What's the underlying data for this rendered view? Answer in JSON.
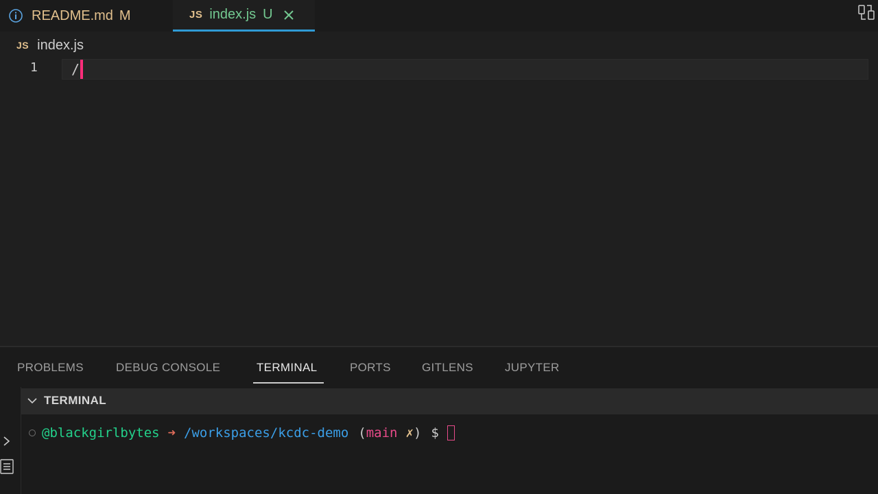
{
  "tabs": [
    {
      "title": "README.md",
      "status": "M"
    },
    {
      "title": "index.js",
      "status": "U"
    }
  ],
  "js_icon_label": "JS",
  "breadcrumb": {
    "file": "index.js"
  },
  "editor": {
    "line_number": "1",
    "code": "/"
  },
  "panel": {
    "tabs": [
      "PROBLEMS",
      "DEBUG CONSOLE",
      "TERMINAL",
      "PORTS",
      "GITLENS",
      "JUPYTER"
    ],
    "active_tab": "TERMINAL",
    "section_title": "TERMINAL"
  },
  "terminal": {
    "user": "@blackgirlbytes",
    "arrow": "➜",
    "path": "/workspaces/kcdc-demo",
    "paren_open": "(",
    "branch": "main",
    "dirty": "✗",
    "paren_close": ")",
    "prompt": "$"
  },
  "colors": {
    "accent": "#2f9bd6",
    "modified": "#e2c08d",
    "untracked": "#73c991",
    "cursor": "#ff2d7a"
  },
  "icons": [
    "info-icon",
    "js-icon",
    "close-icon",
    "compare-changes-icon",
    "chevron-down-icon",
    "chevron-right-icon",
    "list-icon"
  ]
}
